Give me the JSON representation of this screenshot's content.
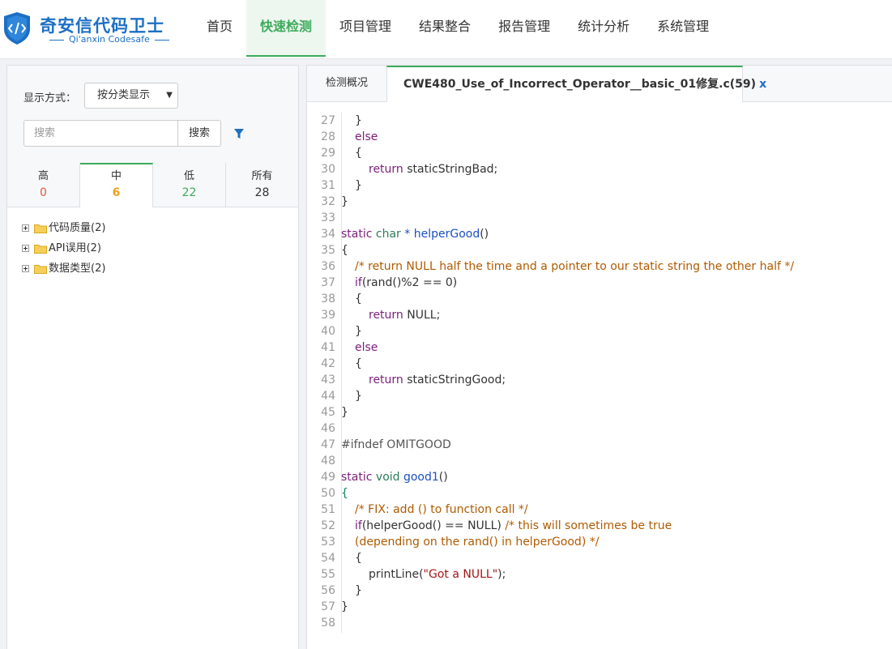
{
  "app": {
    "logo_title": "奇安信代码卫士",
    "logo_subtitle": "Qi'anxin Codesafe"
  },
  "nav": {
    "items": [
      "首页",
      "快速检测",
      "项目管理",
      "结果整合",
      "报告管理",
      "统计分析",
      "系统管理"
    ],
    "active_index": 1
  },
  "left": {
    "display_label": "显示方式：",
    "display_value": "按分类显示",
    "search_placeholder": "搜索",
    "search_button": "搜索",
    "severity_tabs": [
      {
        "label": "高",
        "count": "0",
        "color": "#e8573a"
      },
      {
        "label": "中",
        "count": "6",
        "color": "#f0a020"
      },
      {
        "label": "低",
        "count": "22",
        "color": "#3cab5b"
      },
      {
        "label": "所有",
        "count": "28",
        "color": "#333333"
      }
    ],
    "active_severity_index": 1,
    "tree": [
      "代码质量(2)",
      "API误用(2)",
      "数据类型(2)"
    ]
  },
  "tabs": {
    "overview": "检测概况",
    "file": "CWE480_Use_of_Incorrect_Operator__basic_01修复.c(59)",
    "close": "x"
  },
  "code": {
    "lines": [
      {
        "n": "27",
        "i": 1,
        "t": [
          [
            "}",
            ""
          ]
        ]
      },
      {
        "n": "28",
        "i": 1,
        "t": [
          [
            "else",
            "kw"
          ]
        ]
      },
      {
        "n": "29",
        "i": 1,
        "t": [
          [
            "{",
            ""
          ]
        ]
      },
      {
        "n": "30",
        "i": 2,
        "t": [
          [
            "return",
            "kw"
          ],
          [
            " staticStringBad;",
            ""
          ]
        ]
      },
      {
        "n": "31",
        "i": 1,
        "t": [
          [
            "}",
            ""
          ]
        ]
      },
      {
        "n": "32",
        "i": 0,
        "t": [
          [
            "}",
            ""
          ]
        ]
      },
      {
        "n": "33",
        "i": 0,
        "t": []
      },
      {
        "n": "34",
        "i": 0,
        "t": [
          [
            "static",
            "kw"
          ],
          [
            " char",
            "ty"
          ],
          [
            " * ",
            "fn"
          ],
          [
            "helperGood",
            "fn"
          ],
          [
            "()",
            ""
          ]
        ]
      },
      {
        "n": "35",
        "i": 0,
        "t": [
          [
            "{",
            ""
          ]
        ]
      },
      {
        "n": "36",
        "i": 1,
        "t": [
          [
            "/* return NULL half the time and a pointer to our static string the other half */",
            "cm"
          ]
        ]
      },
      {
        "n": "37",
        "i": 1,
        "t": [
          [
            "if",
            "kw"
          ],
          [
            "(rand()%2 == 0)",
            ""
          ]
        ]
      },
      {
        "n": "38",
        "i": 1,
        "t": [
          [
            "{",
            ""
          ]
        ]
      },
      {
        "n": "39",
        "i": 2,
        "t": [
          [
            "return",
            "kw"
          ],
          [
            " NULL;",
            ""
          ]
        ]
      },
      {
        "n": "40",
        "i": 1,
        "t": [
          [
            "}",
            ""
          ]
        ]
      },
      {
        "n": "41",
        "i": 1,
        "t": [
          [
            "else",
            "kw"
          ]
        ]
      },
      {
        "n": "42",
        "i": 1,
        "t": [
          [
            "{",
            ""
          ]
        ]
      },
      {
        "n": "43",
        "i": 2,
        "t": [
          [
            "return",
            "kw"
          ],
          [
            " staticStringGood;",
            ""
          ]
        ]
      },
      {
        "n": "44",
        "i": 1,
        "t": [
          [
            "}",
            ""
          ]
        ]
      },
      {
        "n": "45",
        "i": 0,
        "t": [
          [
            "}",
            ""
          ]
        ]
      },
      {
        "n": "46",
        "i": 0,
        "t": []
      },
      {
        "n": "47",
        "i": 0,
        "t": [
          [
            "#ifndef OMITGOOD",
            "pp"
          ]
        ]
      },
      {
        "n": "48",
        "i": 0,
        "t": []
      },
      {
        "n": "49",
        "i": 0,
        "t": [
          [
            "static",
            "kw"
          ],
          [
            " void",
            "ty"
          ],
          [
            " good1",
            "fn"
          ],
          [
            "()",
            ""
          ]
        ]
      },
      {
        "n": "50",
        "i": 0,
        "t": [
          [
            "{",
            "nm"
          ]
        ]
      },
      {
        "n": "51",
        "i": 1,
        "t": [
          [
            "/* FIX: add () to function call */",
            "cm"
          ]
        ]
      },
      {
        "n": "52",
        "i": 1,
        "t": [
          [
            "if",
            "kw"
          ],
          [
            "(helperGood() == NULL) ",
            ""
          ],
          [
            "/* this will sometimes be true",
            "cm"
          ]
        ]
      },
      {
        "n": "53",
        "i": 1,
        "t": [
          [
            "(depending on the rand() in helperGood) */",
            "cm"
          ]
        ]
      },
      {
        "n": "54",
        "i": 1,
        "t": [
          [
            "{",
            ""
          ]
        ]
      },
      {
        "n": "55",
        "i": 2,
        "t": [
          [
            "printLine(",
            ""
          ],
          [
            "\"Got a NULL\"",
            "st"
          ],
          [
            ");",
            ""
          ]
        ]
      },
      {
        "n": "56",
        "i": 1,
        "t": [
          [
            "}",
            ""
          ]
        ]
      },
      {
        "n": "57",
        "i": 0,
        "t": [
          [
            "}",
            ""
          ]
        ]
      },
      {
        "n": "58",
        "i": 0,
        "t": []
      }
    ]
  }
}
